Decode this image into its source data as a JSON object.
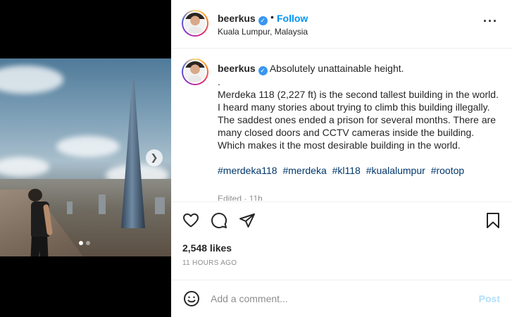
{
  "post": {
    "username": "beerkus",
    "separator": "•",
    "follow_label": "Follow",
    "location": "Kuala Lumpur, Malaysia",
    "more_icon": "more-horizontal-icon"
  },
  "caption": {
    "username": "beerkus",
    "first_line": "Absolutely unattainable height.",
    "dot_line": ".",
    "body": "Merdeka 118 (2,227 ft) is the second tallest building in the world. I heard many stories about trying to climb this building illegally. The saddest ones ended a prison for several months. There are many closed doors and CCTV cameras inside the building. Which makes it the most desirable building in the world.",
    "hashtags": [
      "#merdeka118",
      "#merdeka",
      "#kl118",
      "#kualalumpur",
      "#rootop"
    ],
    "edited": "Edited · 11h"
  },
  "actions": {
    "like_icon": "heart-icon",
    "comment_icon": "comment-icon",
    "share_icon": "send-icon",
    "save_icon": "bookmark-icon"
  },
  "likes": "2,548 likes",
  "time": "11 HOURS AGO",
  "comment": {
    "placeholder": "Add a comment...",
    "post_label": "Post",
    "emoji_icon": "smiley-icon"
  },
  "media": {
    "next_icon": "chevron-right-icon",
    "carousel_total": 2,
    "carousel_active": 1
  }
}
